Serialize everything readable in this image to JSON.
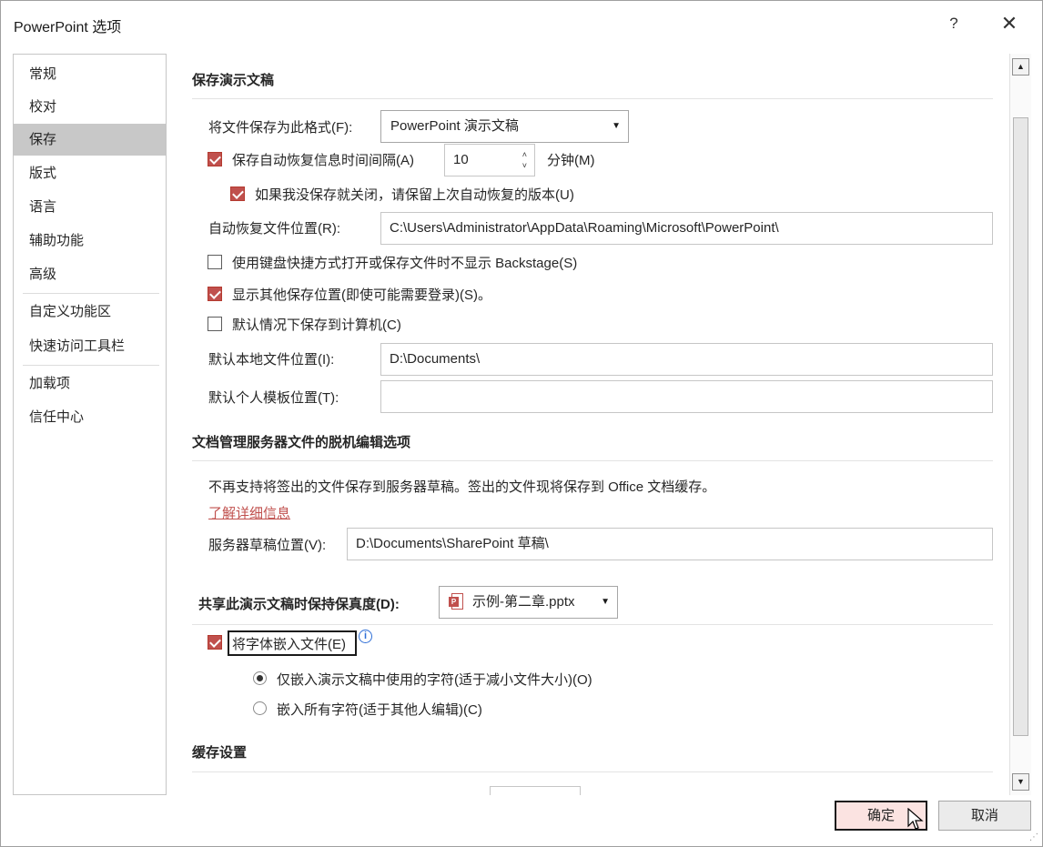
{
  "window": {
    "title": "PowerPoint 选项",
    "help_label": "?",
    "close_label": "✕"
  },
  "nav": {
    "items": [
      {
        "label": "常规"
      },
      {
        "label": "校对"
      },
      {
        "label": "保存",
        "selected": true
      },
      {
        "label": "版式"
      },
      {
        "label": "语言"
      },
      {
        "label": "辅助功能"
      },
      {
        "label": "高级"
      },
      {
        "label": "自定义功能区"
      },
      {
        "label": "快速访问工具栏"
      },
      {
        "label": "加载项"
      },
      {
        "label": "信任中心"
      }
    ]
  },
  "save": {
    "section_title": "保存演示文稿",
    "format_label": "将文件保存为此格式(F):",
    "format_value": "PowerPoint 演示文稿",
    "autorecover_label": "保存自动恢复信息时间间隔(A)",
    "autorecover_checked": true,
    "autorecover_minutes": "10",
    "minutes_label": "分钟(M)",
    "keep_last_label": "如果我没保存就关闭，请保留上次自动恢复的版本(U)",
    "keep_last_checked": true,
    "autorecover_location_label": "自动恢复文件位置(R):",
    "autorecover_location_value": "C:\\Users\\Administrator\\AppData\\Roaming\\Microsoft\\PowerPoint\\",
    "no_backstage_label": "使用键盘快捷方式打开或保存文件时不显示 Backstage(S)",
    "no_backstage_checked": false,
    "show_additional_label": "显示其他保存位置(即使可能需要登录)(S)。",
    "show_additional_checked": true,
    "save_to_computer_label": "默认情况下保存到计算机(C)",
    "save_to_computer_checked": false,
    "local_location_label": "默认本地文件位置(I):",
    "local_location_value": "D:\\Documents\\",
    "template_location_label": "默认个人模板位置(T):",
    "template_location_value": ""
  },
  "offline": {
    "section_title": "文档管理服务器文件的脱机编辑选项",
    "notice": "不再支持将签出的文件保存到服务器草稿。签出的文件现将保存到 Office 文档缓存。",
    "learn_more": "了解详细信息",
    "drafts_label": "服务器草稿位置(V):",
    "drafts_value": "D:\\Documents\\SharePoint 草稿\\"
  },
  "fidelity": {
    "section_title": "共享此演示文稿时保持保真度(D):",
    "file_value": "示例-第二章.pptx",
    "embed_fonts_label": "将字体嵌入文件(E)",
    "embed_fonts_checked": true,
    "info_glyph": "i",
    "embed_used_label": "仅嵌入演示文稿中使用的字符(适于减小文件大小)(O)",
    "embed_used_checked": true,
    "embed_all_label": "嵌入所有字符(适于其他人编辑)(C)",
    "embed_all_checked": false
  },
  "cache": {
    "section_title": "缓存设置"
  },
  "buttons": {
    "ok": "确定",
    "cancel": "取消"
  },
  "colors": {
    "accent": "#c0504d",
    "nav_selected": "#c8c8c8",
    "ok_button_bg": "#fbe3e1",
    "info_blue": "#2f6fd6"
  }
}
